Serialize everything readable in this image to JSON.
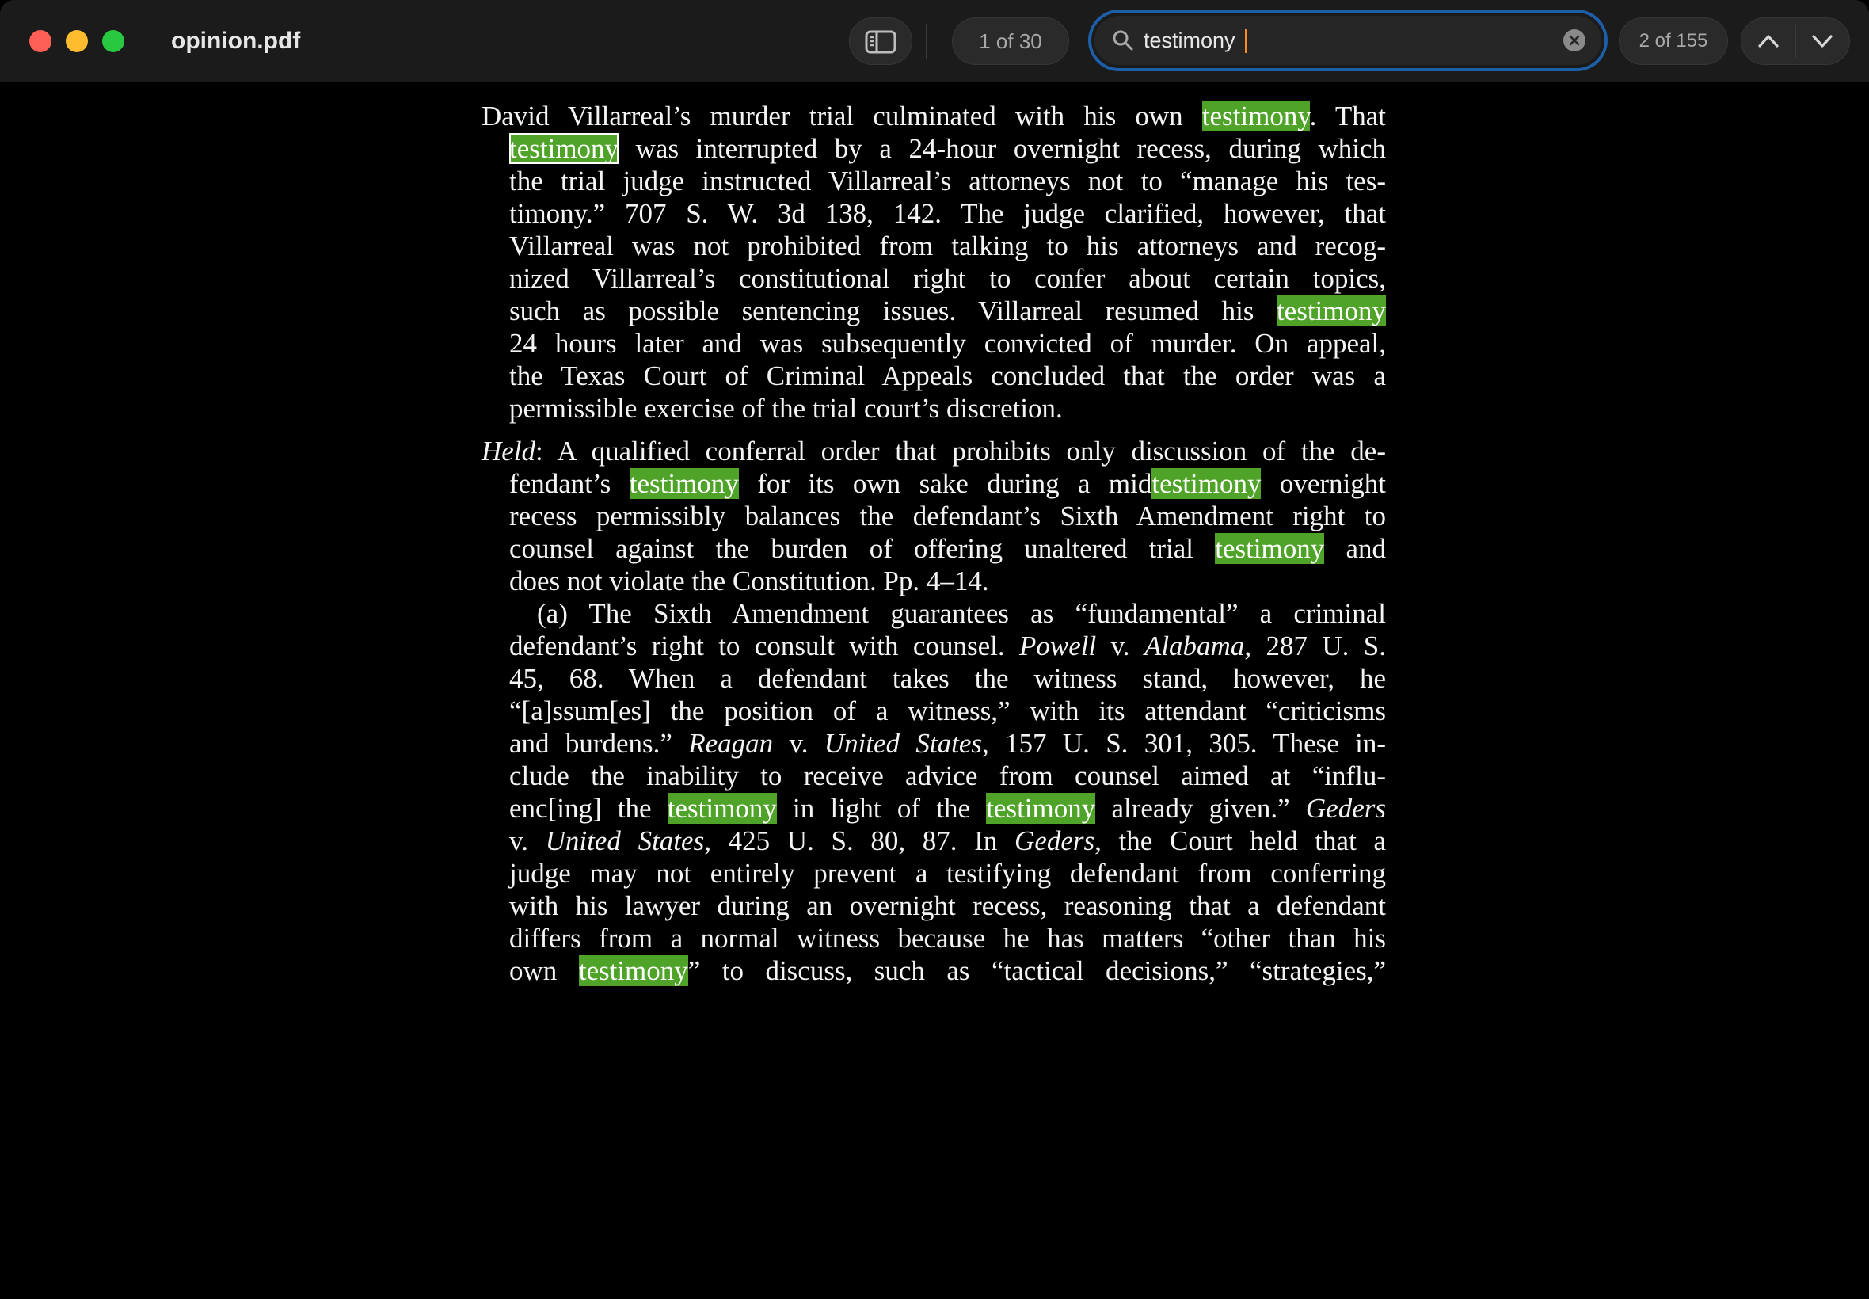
{
  "window": {
    "title": "opinion.pdf"
  },
  "toolbar": {
    "page_indicator": "1 of 30",
    "search": {
      "value": "testimony",
      "match_indicator": "2 of 155"
    }
  },
  "colors": {
    "highlight": "#4ea328",
    "search_focus_ring": "#1d5ea8",
    "caret": "#ff8a1f"
  },
  "icons": {
    "sidebar": "sidebar-toggle-icon",
    "search": "magnifier-icon",
    "clear": "clear-circle-x-icon",
    "prev": "chevron-up-icon",
    "next": "chevron-down-icon"
  },
  "document": {
    "lines": [
      [
        {
          "t": "David Villarreal’s murder trial culminated with his own "
        },
        {
          "t": "testimony",
          "h": true
        },
        {
          "t": ".  That"
        }
      ],
      [
        {
          "t": "testimony",
          "h": true,
          "c": true
        },
        {
          "t": " was interrupted by a 24-hour overnight recess, during which"
        }
      ],
      [
        {
          "t": "the trial judge instructed Villarreal’s attorneys not to “manage his tes-"
        }
      ],
      [
        {
          "t": "timony.”  707 S. W. 3d 138, 142.  The judge clarified, however, that"
        }
      ],
      [
        {
          "t": "Villarreal was not prohibited from talking to his attorneys and recog-"
        }
      ],
      [
        {
          "t": "nized Villarreal’s constitutional right to confer about certain topics,"
        }
      ],
      [
        {
          "t": "such as possible sentencing issues.  Villarreal resumed his "
        },
        {
          "t": "testimony",
          "h": true
        }
      ],
      [
        {
          "t": "24 hours later and was subsequently convicted of murder.  On appeal,"
        }
      ],
      [
        {
          "t": "the Texas Court of Criminal Appeals concluded that the order was a"
        }
      ],
      [
        {
          "t": "permissible exercise of the trial court’s discretion."
        }
      ],
      [
        {
          "t": "Held",
          "i": true
        },
        {
          "t": ": A qualified conferral order that prohibits only discussion of the de-"
        }
      ],
      [
        {
          "t": "fendant’s "
        },
        {
          "t": "testimony",
          "h": true
        },
        {
          "t": " for its own sake during a mid"
        },
        {
          "t": "testimony",
          "h": true
        },
        {
          "t": " overnight"
        }
      ],
      [
        {
          "t": "recess permissibly balances the defendant’s Sixth Amendment right to"
        }
      ],
      [
        {
          "t": "counsel against the burden of offering unaltered trial "
        },
        {
          "t": "testimony",
          "h": true
        },
        {
          "t": " and"
        }
      ],
      [
        {
          "t": "does not violate the Constitution.  Pp. 4–14."
        }
      ],
      [
        {
          "t": "(a) The Sixth Amendment guarantees as “fundamental” a criminal"
        }
      ],
      [
        {
          "t": "defendant’s right to consult with counsel.  "
        },
        {
          "t": "Powell",
          "i": true
        },
        {
          "t": " v. "
        },
        {
          "t": "Alabama",
          "i": true
        },
        {
          "t": ", 287 U. S."
        }
      ],
      [
        {
          "t": "45, 68.  When a defendant takes the witness stand, however, he"
        }
      ],
      [
        {
          "t": "“[a]ssum[es] the position of a witness,” with its attendant “criticisms"
        }
      ],
      [
        {
          "t": "and burdens.”  "
        },
        {
          "t": "Reagan",
          "i": true
        },
        {
          "t": " v. "
        },
        {
          "t": "United States",
          "i": true
        },
        {
          "t": ", 157 U. S. 301, 305.  These in-"
        }
      ],
      [
        {
          "t": "clude the inability to receive advice from counsel aimed at “influ-"
        }
      ],
      [
        {
          "t": "enc[ing] the "
        },
        {
          "t": "testimony",
          "h": true
        },
        {
          "t": " in light of the "
        },
        {
          "t": "testimony",
          "h": true
        },
        {
          "t": " already given.”  "
        },
        {
          "t": "Geders",
          "i": true
        }
      ],
      [
        {
          "t": "v. "
        },
        {
          "t": "United States",
          "i": true
        },
        {
          "t": ", 425 U. S. 80, 87.  In "
        },
        {
          "t": "Geders",
          "i": true
        },
        {
          "t": ", the Court held that a"
        }
      ],
      [
        {
          "t": "judge may not entirely prevent a testifying defendant from conferring"
        }
      ],
      [
        {
          "t": "with his lawyer during an overnight recess, reasoning that a defendant"
        }
      ],
      [
        {
          "t": "differs from a normal witness because he has matters “other than his"
        }
      ],
      [
        {
          "t": "own "
        },
        {
          "t": "testimony",
          "h": true
        },
        {
          "t": "” to discuss, such as “tactical decisions,” “strategies,”"
        }
      ]
    ]
  }
}
